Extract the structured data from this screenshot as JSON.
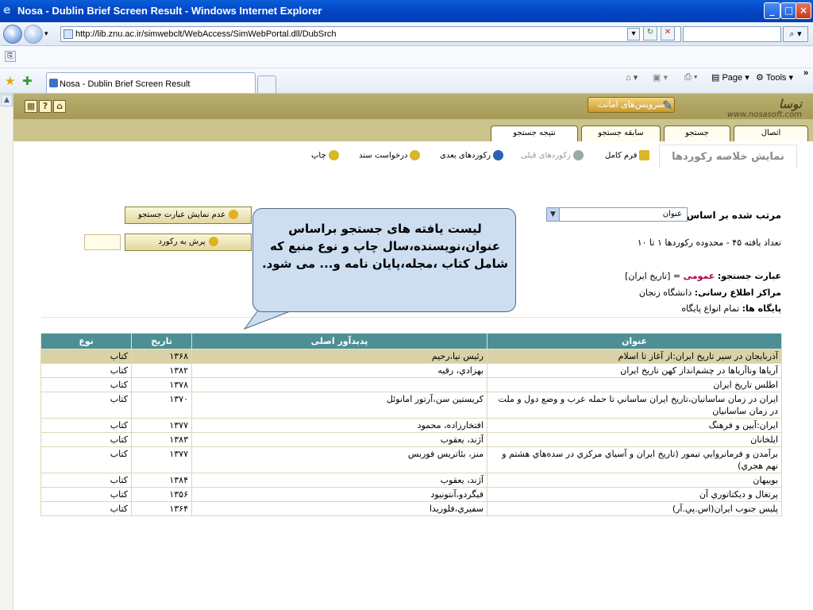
{
  "window": {
    "title": "Nosa - Dublin Brief Screen Result - Windows Internet Explorer",
    "controls": [
      "_",
      "□",
      "×"
    ]
  },
  "address": {
    "url": "http://lib.znu.ac.ir/simwebclt/WebAccess/SimWebPortal.dll/DubSrch"
  },
  "browser_tab": {
    "label": "Nosa - Dublin Brief Screen Result"
  },
  "command_bar": {
    "page_label": "Page",
    "tools_label": "Tools"
  },
  "app": {
    "logo_name": "نوسا",
    "logo_url": "www.nosasoft.com",
    "service_button": "سرویس‌های امانت",
    "tabs": [
      "اتصال",
      "جستجو",
      "سابقه جستجو",
      "نتیجه جستجو"
    ],
    "page_title": "نمایش خلاصه رکوردها",
    "actions": {
      "full_form": "فرم کامل",
      "prev_records": "رکوردهای قبلی",
      "next_records": "رکوردهای بعدی",
      "request_doc": "درخواست سند",
      "print": "چاپ"
    },
    "sort": {
      "label": "مرتب شده بر اساس:",
      "value": "عنوان"
    },
    "found_text": "تعداد یافته ۴۵ - محدوده رکوردها ۱ تا ۱۰",
    "query_label": "عبارت جستجو:",
    "query_field": "عمومی",
    "query_value": " = [تاریخ ایران]",
    "centers_label": "مراکز اطلاع رسانی:",
    "centers_value": "دانشگاه زنجان",
    "bases_label": "پایگاه ها:",
    "bases_value": "تمام انواع پایگاه",
    "hide_query_button": "عدم نمایش عبارت جستجو",
    "goto_record_button": "پرش به رکورد"
  },
  "callout": {
    "text": "لیست یافته های جستجو براساس عنوان،نویسنده،سال چاپ و نوع منبع که شامل کتاب ،مجله،پایان نامه و... می شود."
  },
  "table": {
    "headers": [
      "عنوان",
      "پدیدآور اصلی",
      "تاریخ",
      "نوع"
    ],
    "rows": [
      [
        "آذربايجان در سير تاريخ ايران:از آغاز تا اسلام",
        "رئيس نيا،رحيم",
        "۱۳۶۸",
        "کتاب"
      ],
      [
        "آرياها وناآرياها در چشم‌انداز کهن تاريخ ايران",
        "بهزادي، رقيه",
        "۱۳۸۲",
        "کتاب"
      ],
      [
        "اطلس تاريخ ايران",
        "",
        "۱۳۷۸",
        "کتاب"
      ],
      [
        "ايران در زمان ساسانيان،تاريخ ايران ساساني تا حمله عرب و وضع دول و ملت در زمان ساسانيان",
        "کريستين سن،آرتور امانوئل",
        "۱۳۷۰",
        "کتاب"
      ],
      [
        "ايران:آيين و فرهنگ",
        "افتخارزاده، محمود",
        "۱۳۷۷",
        "کتاب"
      ],
      [
        "ايلخانان",
        "آژند، يعقوب",
        "۱۳۸۳",
        "کتاب"
      ],
      [
        "برآمدن و فرمانروايي تيمور (تاريخ ايران و آسياي مرکزي در سده‌هاي هشتم و نهم هجري)",
        "منز، بئاتريس فوربس",
        "۱۳۷۷",
        "کتاب"
      ],
      [
        "بوييهان",
        "آژند، يعقوب",
        "۱۳۸۴",
        "کتاب"
      ],
      [
        "پرتغال و ديکتاتوري آن",
        "فيگردو،آنتونيود",
        "۱۳۵۶",
        "کتاب"
      ],
      [
        "پليس جنوب ايران(اس.پي.آر)",
        "سفيري،فلوريدا",
        "۱۳۶۴",
        "کتاب"
      ]
    ]
  }
}
